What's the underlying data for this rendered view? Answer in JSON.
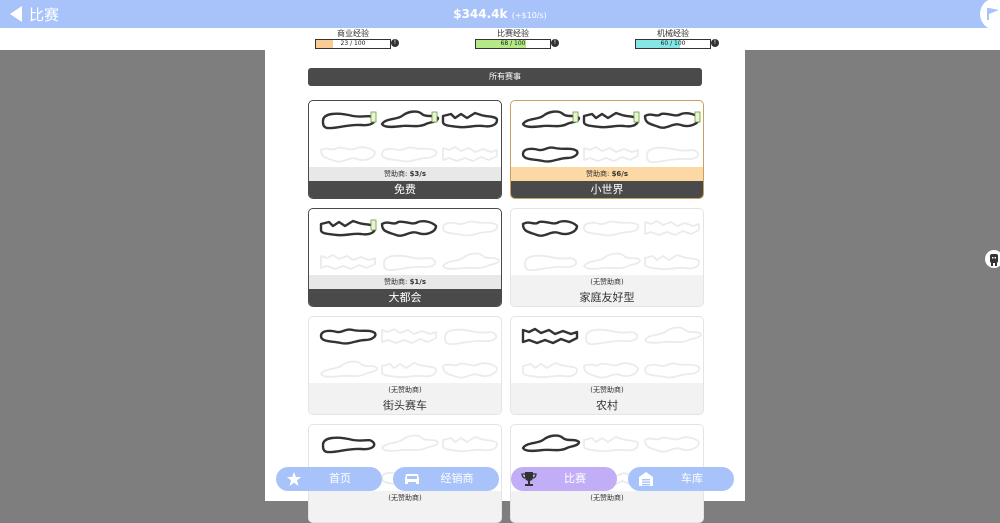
{
  "header": {
    "back_icon": "back-arrow-icon",
    "title": "比赛",
    "money": "$344.4k",
    "money_rate": "(+$10/s)",
    "flag_icon": "flag-icon"
  },
  "experience": [
    {
      "label": "商业经验",
      "value": "23 / 100",
      "progress": 0.23,
      "color": "#f9cc95"
    },
    {
      "label": "比赛经验",
      "value": "68 / 100",
      "progress": 0.68,
      "color": "#b3e986"
    },
    {
      "label": "机械经验",
      "value": "60 / 100",
      "progress": 0.6,
      "color": "#86e6e6"
    }
  ],
  "section_header": "所有赛事",
  "series": [
    {
      "name": "免费",
      "sponsor_label": "赞助商:",
      "sponsor_value": "$3/s",
      "unlocked": 3,
      "style": "dark"
    },
    {
      "name": "小世界",
      "sponsor_label": "赞助商:",
      "sponsor_value": "$6/s",
      "unlocked": 4,
      "style": "amber"
    },
    {
      "name": "大都会",
      "sponsor_label": "赞助商:",
      "sponsor_value": "$1/s",
      "unlocked": 2,
      "style": "dark"
    },
    {
      "name": "家庭友好型",
      "sponsor_label": "(无赞助商)",
      "sponsor_value": "",
      "unlocked": 1,
      "style": "light"
    },
    {
      "name": "街头赛车",
      "sponsor_label": "(无赞助商)",
      "sponsor_value": "",
      "unlocked": 1,
      "style": "light"
    },
    {
      "name": "农村",
      "sponsor_label": "(无赞助商)",
      "sponsor_value": "",
      "unlocked": 1,
      "style": "light"
    },
    {
      "name": "",
      "sponsor_label": "(无赞助商)",
      "sponsor_value": "",
      "unlocked": 1,
      "style": "light"
    },
    {
      "name": "",
      "sponsor_label": "(无赞助商)",
      "sponsor_value": "",
      "unlocked": 1,
      "style": "light"
    }
  ],
  "nav": [
    {
      "label": "首页",
      "icon": "star-icon",
      "active": false
    },
    {
      "label": "经销商",
      "icon": "car-icon",
      "active": false
    },
    {
      "label": "比赛",
      "icon": "trophy-icon",
      "active": true
    },
    {
      "label": "车库",
      "icon": "garage-icon",
      "active": false
    }
  ],
  "colors": {
    "topbar": "#a7c3fa",
    "active_nav": "#c2aef7",
    "card_dark": "#4a4a4a",
    "sponsor_highlight": "#fcd8a4"
  }
}
